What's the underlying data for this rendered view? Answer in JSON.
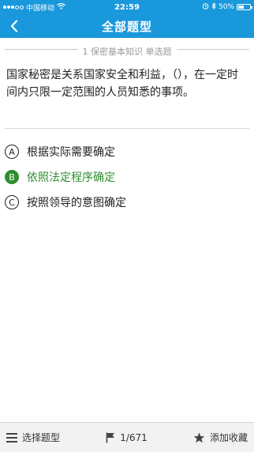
{
  "status_bar": {
    "carrier": "中国移动",
    "time": "22:59",
    "battery": "50%",
    "battery_level": 0.5
  },
  "nav": {
    "title": "全部题型",
    "back_icon": "chevron-left-icon"
  },
  "section": {
    "label": "1 保密基本知识  单选题"
  },
  "question": {
    "text": "国家秘密是关系国家安全和利益，（），在一定时间内只限一定范围的人员知悉的事项。"
  },
  "options": [
    {
      "letter": "A",
      "text": "根据实际需要确定",
      "selected": false
    },
    {
      "letter": "B",
      "text": "依照法定程序确定",
      "selected": true
    },
    {
      "letter": "C",
      "text": "按照领导的意图确定",
      "selected": false
    }
  ],
  "colors": {
    "accent": "#1a98dc",
    "selected": "#2f8f2f"
  },
  "bottom_bar": {
    "select_type_label": "选择题型",
    "progress": "1/671",
    "favorite_label": "添加收藏"
  }
}
